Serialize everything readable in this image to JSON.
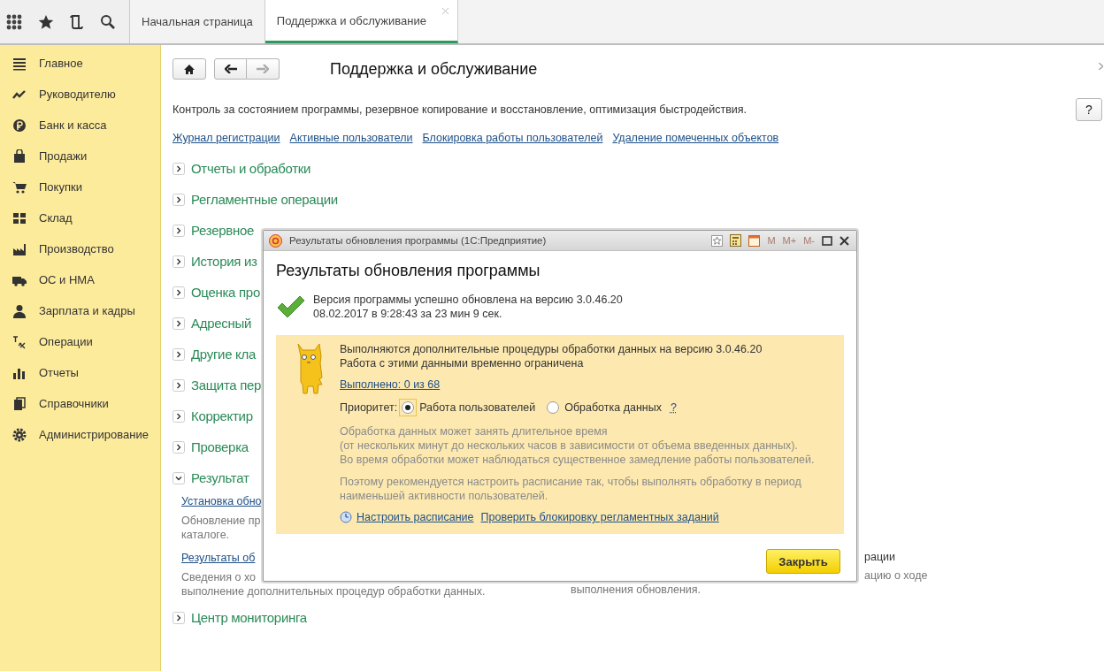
{
  "tabs": [
    {
      "label": "Начальная страница",
      "selected": false
    },
    {
      "label": "Поддержка и обслуживание",
      "selected": true
    }
  ],
  "sidebar": {
    "items": [
      {
        "label": "Главное"
      },
      {
        "label": "Руководителю"
      },
      {
        "label": "Банк и касса"
      },
      {
        "label": "Продажи"
      },
      {
        "label": "Покупки"
      },
      {
        "label": "Склад"
      },
      {
        "label": "Производство"
      },
      {
        "label": "ОС и НМА"
      },
      {
        "label": "Зарплата и кадры"
      },
      {
        "label": "Операции"
      },
      {
        "label": "Отчеты"
      },
      {
        "label": "Справочники"
      },
      {
        "label": "Администрирование"
      }
    ]
  },
  "page": {
    "title": "Поддержка и обслуживание",
    "help_button": "?",
    "description": "Контроль за состоянием программы, резервное копирование и восстановление, оптимизация быстродействия.",
    "links": [
      "Журнал регистрации",
      "Активные пользователи",
      "Блокировка работы пользователей",
      "Удаление помеченных объектов"
    ],
    "groups": [
      {
        "label": "Отчеты и обработки",
        "expanded": false
      },
      {
        "label": "Регламентные операции",
        "expanded": false
      },
      {
        "label": "Резервное",
        "expanded": false
      },
      {
        "label": "История из",
        "expanded": false
      },
      {
        "label": "Оценка про",
        "expanded": false
      },
      {
        "label": "Адресный",
        "expanded": false
      },
      {
        "label": "Другие кла",
        "expanded": false
      },
      {
        "label": "Защита пер",
        "expanded": false
      },
      {
        "label": "Корректир",
        "expanded": false
      },
      {
        "label": "Проверка",
        "expanded": false
      },
      {
        "label": "Результат",
        "expanded": true,
        "column_1": [
          {
            "kind": "link",
            "lines": [
              "Установка обно"
            ]
          },
          {
            "kind": "note",
            "lines": [
              "Обновление пр",
              "каталоге."
            ]
          },
          {
            "kind": "link",
            "lines": [
              "Результаты об"
            ]
          },
          {
            "kind": "note",
            "lines": [
              "Сведения о хо",
              "выполнение дополнительных процедур обработки данных."
            ]
          }
        ],
        "column_2": [
          {
            "kind": "text",
            "lines": [
              "рации"
            ]
          },
          {
            "kind": "note",
            "lines": [
              "ацию о ходе",
              "выполнения обновления."
            ]
          }
        ]
      },
      {
        "label": "Центр мониторинга",
        "expanded": false
      }
    ]
  },
  "dialog": {
    "window_title": "Результаты обновления программы  (1С:Предприятие)",
    "memory_buttons": [
      {
        "label": "M",
        "disabled": true
      },
      {
        "label": "M+",
        "disabled": true
      },
      {
        "label": "M-",
        "disabled": true
      }
    ],
    "title": "Результаты обновления программы",
    "success_lines": [
      "Версия программы успешно обновлена на версию 3.0.46.20",
      "08.02.2017 в 9:28:43 за 23 мин 9 сек."
    ],
    "notice_lines": [
      "Выполняются дополнительные процедуры обработки данных на версию 3.0.46.20",
      "Работа с этими данными временно ограничена"
    ],
    "progress_link": "Выполнено: 0 из 68",
    "priority": {
      "label": "Приоритет:",
      "options": [
        {
          "label": "Работа пользователей",
          "selected": true
        },
        {
          "label": "Обработка данных",
          "selected": false
        }
      ],
      "help": "?"
    },
    "hint_1": [
      "Обработка данных может занять длительное время",
      "(от нескольких минут до нескольких часов в зависимости от объема введенных данных).",
      "Во время обработки может наблюдаться существенное замедление работы пользователей."
    ],
    "hint_2": [
      "Поэтому рекомендуется настроить расписание так, чтобы выполнять обработку в период",
      "наименьшей активности пользователей."
    ],
    "links": [
      "Настроить расписание",
      "Проверить блокировку регламентных заданий"
    ],
    "close_button": "Закрыть"
  }
}
